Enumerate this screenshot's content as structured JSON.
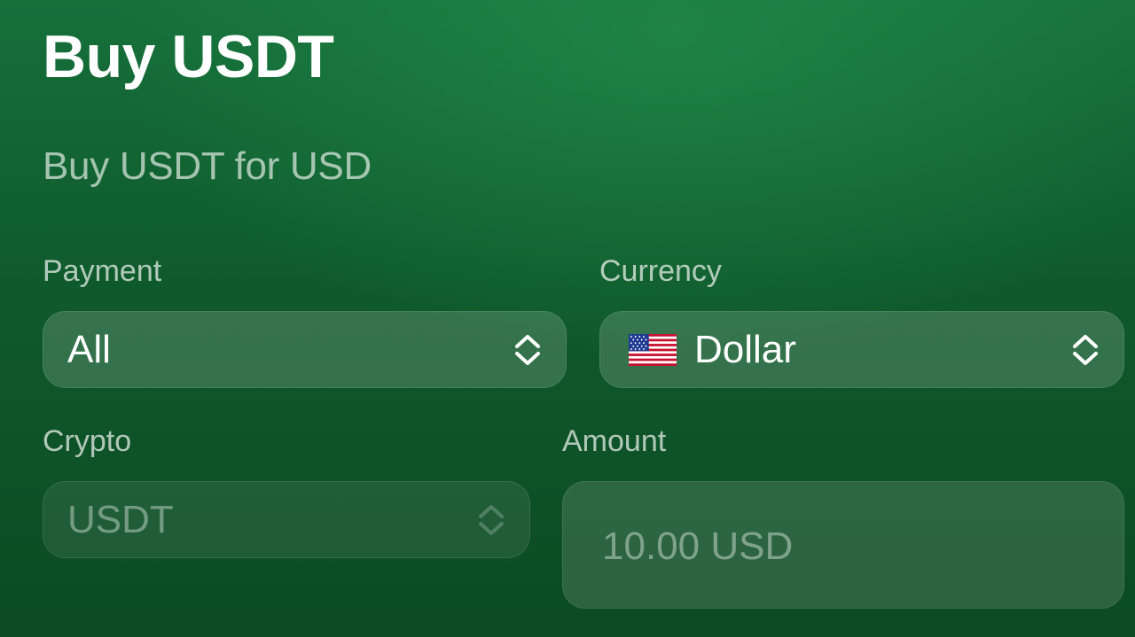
{
  "header": {
    "title": "Buy USDT",
    "subtitle": "Buy USDT for USD"
  },
  "filters": {
    "payment": {
      "label": "Payment",
      "value": "All",
      "icon": "chevron-up-down-icon"
    },
    "currency": {
      "label": "Currency",
      "value": "Dollar",
      "flag_icon": "us-flag-icon",
      "icon": "chevron-up-down-icon"
    },
    "crypto": {
      "label": "Crypto",
      "value": "USDT",
      "disabled": true,
      "icon": "chevron-up-down-icon"
    },
    "amount": {
      "label": "Amount",
      "value": "",
      "placeholder": "10.00 USD"
    }
  },
  "colors": {
    "background": "#0f5a2c",
    "field_fill": "rgba(255,255,255,0.16)"
  }
}
